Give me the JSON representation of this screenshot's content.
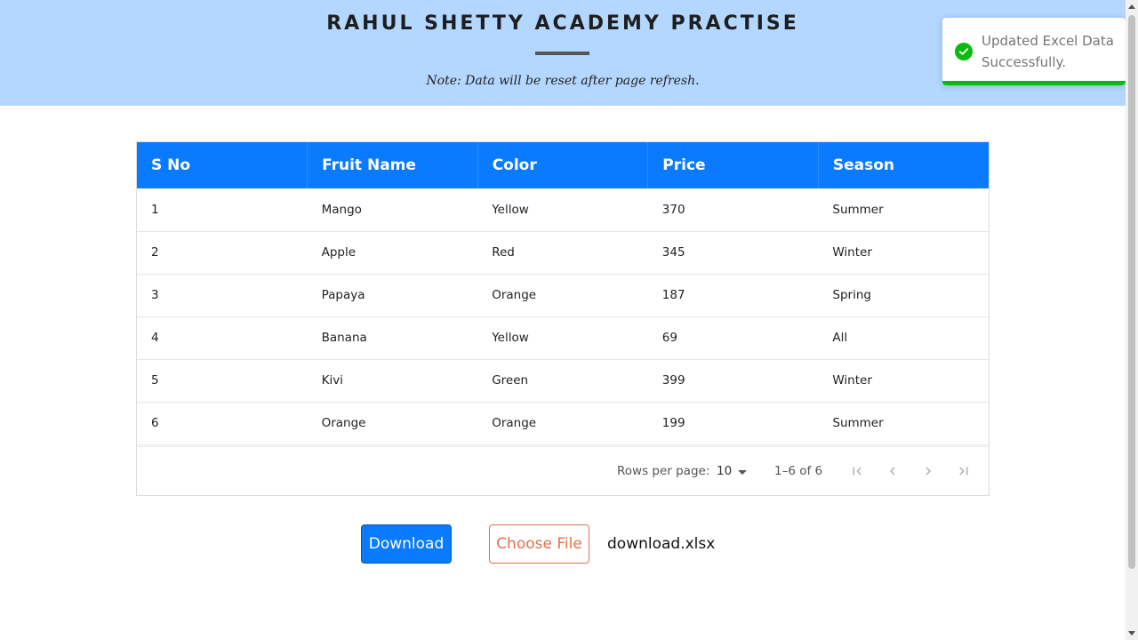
{
  "header": {
    "title": "RAHUL SHETTY ACADEMY PRACTISE",
    "note": "Note: Data will be reset after page refresh."
  },
  "table": {
    "columns": [
      "S No",
      "Fruit Name",
      "Color",
      "Price",
      "Season"
    ],
    "rows": [
      [
        "1",
        "Mango",
        "Yellow",
        "370",
        "Summer"
      ],
      [
        "2",
        "Apple",
        "Red",
        "345",
        "Winter"
      ],
      [
        "3",
        "Papaya",
        "Orange",
        "187",
        "Spring"
      ],
      [
        "4",
        "Banana",
        "Yellow",
        "69",
        "All"
      ],
      [
        "5",
        "Kivi",
        "Green",
        "399",
        "Winter"
      ],
      [
        "6",
        "Orange",
        "Orange",
        "199",
        "Summer"
      ]
    ]
  },
  "pagination": {
    "rows_per_page_label": "Rows per page:",
    "rows_per_page_value": "10",
    "range": "1–6 of 6",
    "icons": [
      "first-page-icon",
      "prev-page-icon",
      "next-page-icon",
      "last-page-icon"
    ]
  },
  "actions": {
    "download_label": "Download",
    "choose_file_label": "Choose File",
    "file_name": "download.xlsx"
  },
  "toast": {
    "message": "Updated Excel Data Successfully.",
    "icon": "check-circle-icon"
  },
  "colors": {
    "header_bg": "#b3d7ff",
    "table_header_bg": "#0a7bff",
    "download_bg": "#0a7bff",
    "choose_file_accent": "#e0714f",
    "toast_success": "#07bc0c"
  }
}
